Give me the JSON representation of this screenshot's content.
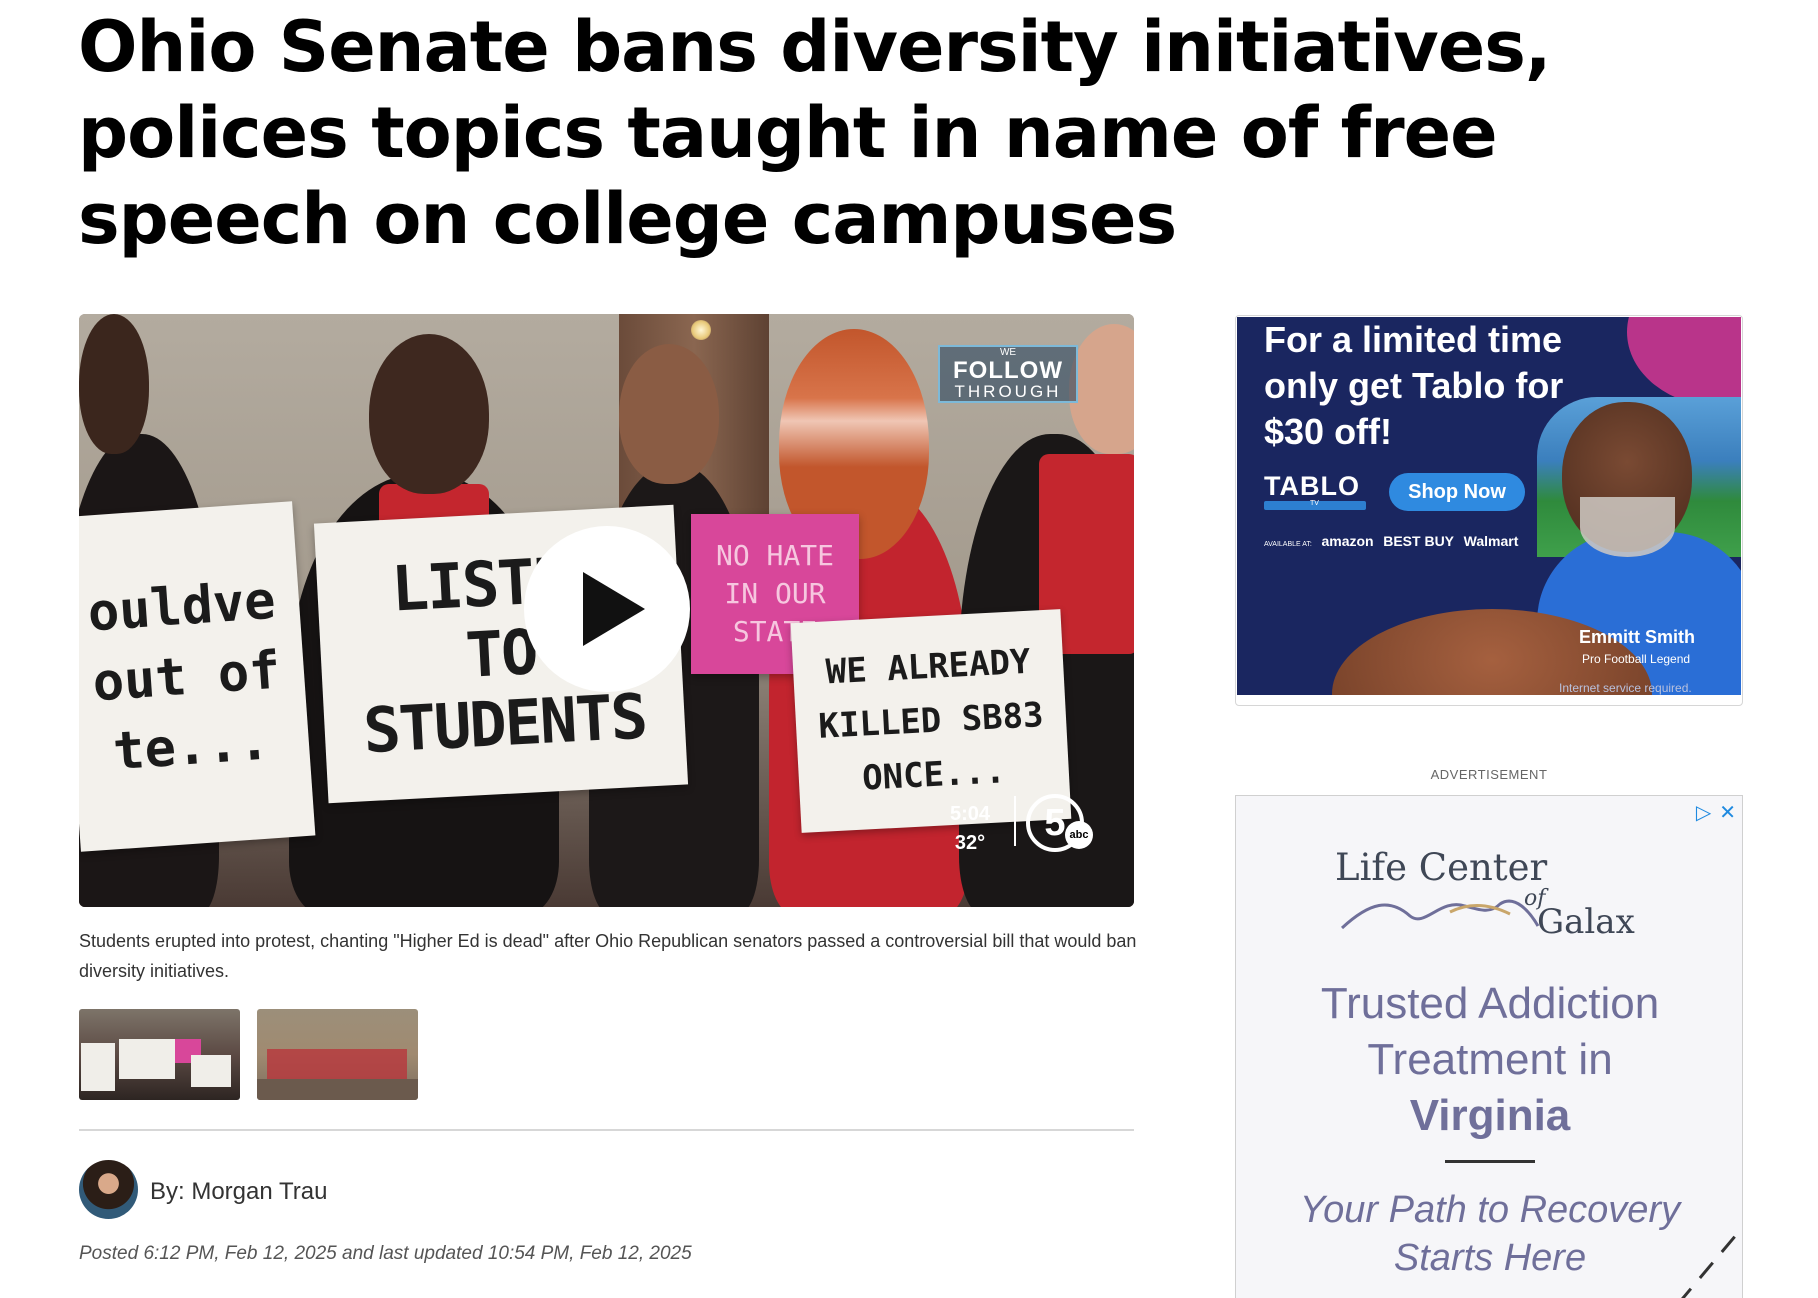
{
  "article": {
    "headline": "Ohio Senate bans diversity initiatives, polices topics taught in name of free speech on college campuses",
    "caption": "Students erupted into protest, chanting \"Higher Ed is dead\" after Ohio Republican senators passed a controversial bill that would ban diversity initiatives.",
    "byline": "By: Morgan Trau",
    "posted_prefix": "Posted",
    "posted_time": "6:12 PM, Feb 12, 2025",
    "updated_prefix": "and last updated",
    "updated_time": "10:54 PM, Feb 12, 2025"
  },
  "video": {
    "signs": {
      "left": "ouldve\nout of\nte...",
      "listen": "LISTEN\nTO\nSTUDENTS",
      "pink": "NO HATE\nIN OUR\nSTATE",
      "already": "WE ALREADY\nKILLED SB83\nONCE..."
    },
    "overlay": {
      "we": "WE",
      "follow": "FOLLOW",
      "through": "THROUGH",
      "time": "5:04",
      "temp": "32°",
      "channel": "5",
      "network": "abc"
    },
    "play_icon": "play-icon"
  },
  "thumbnails": [
    {
      "name": "thumbnail-protest-signs"
    },
    {
      "name": "thumbnail-hearing-room"
    }
  ],
  "ad1": {
    "title": "For a limited time only get Tablo for $30 off!",
    "brand": "TABLO",
    "brand_sub": "TV",
    "cta": "Shop Now",
    "available": "AVAILABLE AT:",
    "retailers": [
      "amazon",
      "BEST BUY",
      "Walmart"
    ],
    "spokesperson": "Emmitt Smith",
    "spokesperson_title": "Pro Football Legend",
    "disclaimer": "Internet service required.",
    "colors": {
      "background": "#1a2660",
      "accent": "#b9348a",
      "button": "#2f8ae0"
    }
  },
  "ad_label": "ADVERTISEMENT",
  "ad2": {
    "logo_main": "Life Center",
    "logo_of": "of",
    "logo_place": "Galax",
    "line1": "Trusted Addiction",
    "line2": "Treatment in",
    "line3": "Virginia",
    "tagline1": "Your Path to Recovery",
    "tagline2": "Starts Here",
    "adchoices_icon": "adchoices-icon",
    "close_icon": "close-icon",
    "colors": {
      "text": "#6f6f9a",
      "background": "#f6f6f9"
    }
  }
}
